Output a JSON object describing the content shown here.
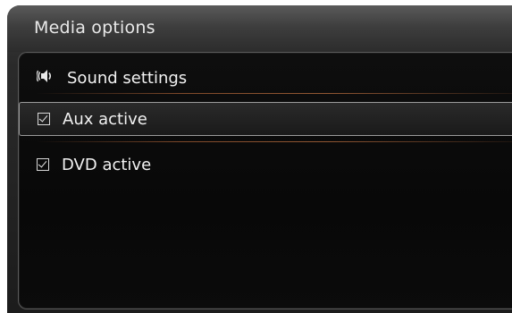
{
  "header": {
    "title": "Media options"
  },
  "menu": {
    "items": [
      {
        "label": "Sound settings",
        "icon": "speaker-icon",
        "type": "submenu"
      },
      {
        "label": "Aux active",
        "icon": "checkbox-checked-icon",
        "type": "checkbox",
        "checked": true,
        "selected": true
      },
      {
        "label": "DVD active",
        "icon": "checkbox-checked-icon",
        "type": "checkbox",
        "checked": true,
        "selected": false
      }
    ]
  },
  "colors": {
    "accent_separator": "#a0603a",
    "text": "#f2f2f2",
    "highlight_border": "#9a9a9a"
  }
}
